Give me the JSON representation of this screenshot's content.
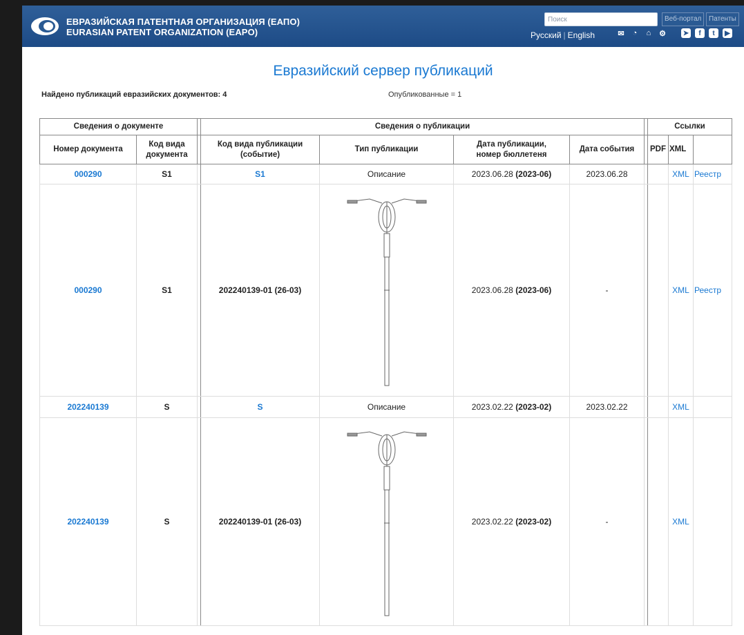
{
  "header": {
    "org_ru": "ЕВРАЗИЙСКАЯ ПАТЕНТНАЯ ОРГАНИЗАЦИЯ (ЕАПО)",
    "org_en": "EURASIAN PATENT ORGANIZATION (EAPO)",
    "search_placeholder": "Поиск",
    "btn_portal": "Веб-портал",
    "btn_patents": "Патенты",
    "lang_ru": "Русский",
    "lang_sep": "|",
    "lang_en": "English",
    "icons": [
      "mail-icon",
      "rss-icon",
      "home-icon",
      "settings-icon",
      "telegram-icon",
      "facebook-icon",
      "twitter-icon",
      "youtube-icon"
    ]
  },
  "page": {
    "title": "Евразийский сервер публикаций",
    "found_text": "Найдено публикаций евразийских документов: 4",
    "published_text": "Опубликованные = 1"
  },
  "table": {
    "group_headers": [
      "Сведения о документе",
      "Сведения о публикации",
      "Ссылки"
    ],
    "headers": {
      "doc_num": "Номер документа",
      "doc_kind_1": "Код вида",
      "doc_kind_2": "документа",
      "pub_kind_1": "Код вида публикации",
      "pub_kind_2": "(событие)",
      "pub_type": "Тип публикации",
      "pub_date_1": "Дата публикации,",
      "pub_date_2": "номер бюллетеня",
      "event_date": "Дата события",
      "pdf": "PDF",
      "xml": "XML"
    },
    "rows": [
      {
        "doc": "000290",
        "kind": "S1",
        "pub_kind": "S1",
        "pub_type": "Описание",
        "pub_date": "2023.06.28",
        "bulletin": "(2023-06)",
        "event_date": "2023.06.28",
        "xml": "XML",
        "registry": "Реестр"
      },
      {
        "doc": "000290",
        "kind": "S1",
        "pub_kind": "202240139-01 (26-03)",
        "pub_date": "2023.06.28",
        "bulletin": "(2023-06)",
        "event_date": "-",
        "xml": "XML",
        "registry": "Реестр"
      },
      {
        "doc": "202240139",
        "kind": "S",
        "pub_kind": "S",
        "pub_type": "Описание",
        "pub_date": "2023.02.22",
        "bulletin": "(2023-02)",
        "event_date": "2023.02.22",
        "xml": "XML",
        "registry": ""
      },
      {
        "doc": "202240139",
        "kind": "S",
        "pub_kind": "202240139-01 (26-03)",
        "pub_date": "2023.02.22",
        "bulletin": "(2023-02)",
        "event_date": "-",
        "xml": "XML",
        "registry": ""
      }
    ]
  },
  "colors": {
    "header_bg": "#1d4b86",
    "link": "#1a79d2"
  }
}
